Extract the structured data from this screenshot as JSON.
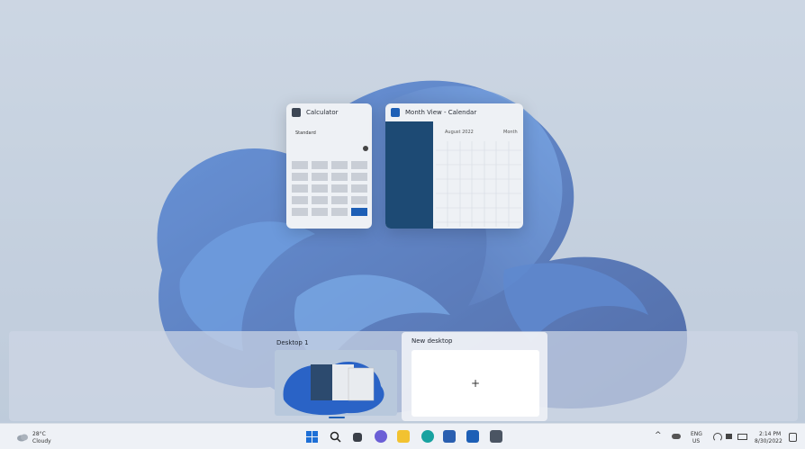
{
  "windows": {
    "calculator": {
      "title": "Calculator",
      "mode": "Standard"
    },
    "calendar": {
      "title": "Month View - Calendar",
      "month": "August 2022",
      "view": "Month"
    }
  },
  "task_view": {
    "desktops": [
      {
        "label": "Desktop 1"
      },
      {
        "label": "New desktop",
        "add_symbol": "+"
      }
    ]
  },
  "taskbar": {
    "weather": {
      "temp": "28°C",
      "condition": "Cloudy",
      "icon": "cloud-icon"
    },
    "language": {
      "line1": "ENG",
      "line2": "US"
    },
    "clock": {
      "time": "2:14 PM",
      "date": "8/30/2022"
    }
  },
  "colors": {
    "accent": "#1d5fb6",
    "calendar_sidebar": "#1d4a74"
  }
}
